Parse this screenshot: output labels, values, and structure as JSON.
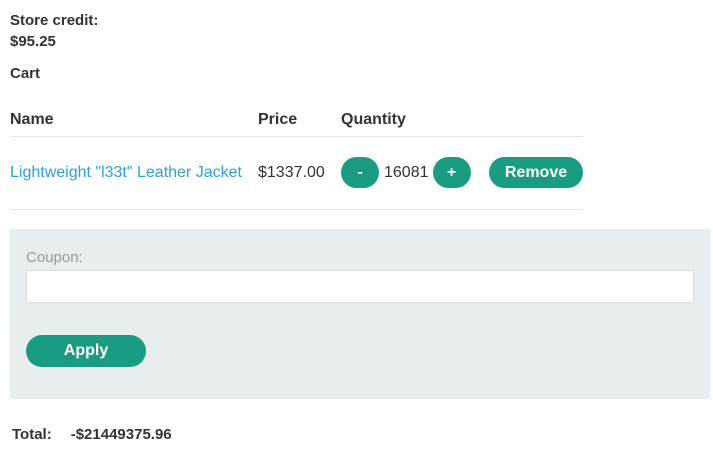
{
  "store_credit": {
    "label": "Store credit:",
    "value": "$95.25"
  },
  "cart": {
    "heading": "Cart",
    "columns": {
      "name": "Name",
      "price": "Price",
      "quantity": "Quantity"
    },
    "items": [
      {
        "name": "Lightweight \"l33t\" Leather Jacket",
        "price": "$1337.00",
        "quantity": "16081",
        "decrement_label": "-",
        "increment_label": "+",
        "remove_label": "Remove"
      }
    ]
  },
  "coupon": {
    "label": "Coupon:",
    "value": "",
    "apply_label": "Apply"
  },
  "total": {
    "label": "Total:",
    "value": "-$21449375.96"
  },
  "colors": {
    "accent": "#1a9c82",
    "link": "#2aa3d6",
    "panel_bg": "#e8eef0"
  }
}
